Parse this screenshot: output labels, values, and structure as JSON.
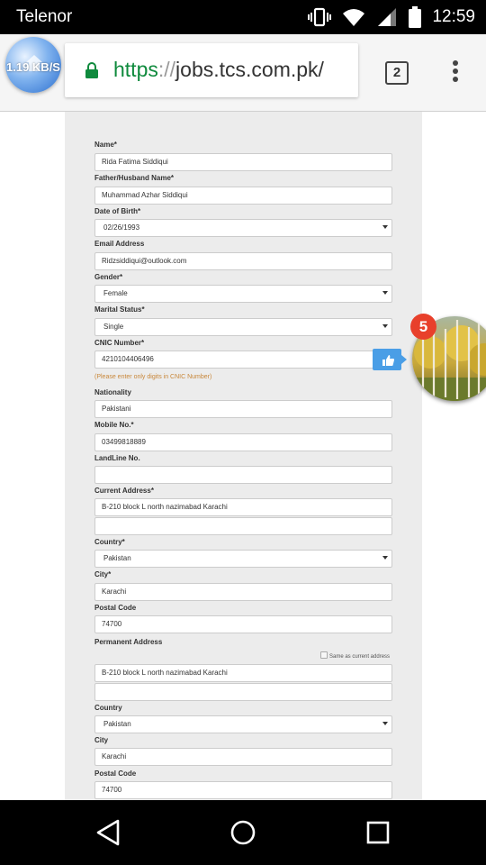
{
  "status_bar": {
    "carrier": "Telenor",
    "time": "12:59",
    "icons": [
      "vibrate-icon",
      "wifi-icon",
      "signal-icon",
      "battery-icon"
    ]
  },
  "browser": {
    "url_scheme": "https",
    "url_sep": "://",
    "url_rest": "jobs.tcs.com.pk/",
    "tab_count": "2",
    "speed_bubble": "1.19 KB/S"
  },
  "form": {
    "name": {
      "label": "Name*",
      "value": "Rida Fatima Siddiqui"
    },
    "father": {
      "label": "Father/Husband Name*",
      "value": "Muhammad Azhar Siddiqui"
    },
    "dob": {
      "label": "Date of Birth*",
      "value": "02/26/1993"
    },
    "email": {
      "label": "Email Address",
      "value": "Ridzsiddiqui@outlook.com"
    },
    "gender": {
      "label": "Gender*",
      "value": "Female"
    },
    "marital": {
      "label": "Marital Status*",
      "value": "Single"
    },
    "cnic": {
      "label": "CNIC Number*",
      "value": "4210104406496",
      "hint": "(Please enter only digits in CNIC Number)"
    },
    "nationality": {
      "label": "Nationality",
      "value": "Pakistani"
    },
    "mobile": {
      "label": "Mobile No.*",
      "value": "03499818889"
    },
    "landline": {
      "label": "LandLine No.",
      "value": ""
    },
    "current_address": {
      "label": "Current Address*",
      "line1": "B-210 block L north nazimabad Karachi",
      "line2": ""
    },
    "country": {
      "label": "Country*",
      "value": "Pakistan"
    },
    "city": {
      "label": "City*",
      "value": "Karachi"
    },
    "postal": {
      "label": "Postal Code",
      "value": "74700"
    },
    "permanent_address": {
      "label": "Permanent Address",
      "same_label": "Same as current address",
      "same_checked": false,
      "line1": "B-210 block L north nazimabad Karachi",
      "line2": ""
    },
    "perm_country": {
      "label": "Country",
      "value": "Pakistan"
    },
    "perm_city": {
      "label": "City",
      "value": "Karachi"
    },
    "perm_postal": {
      "label": "Postal Code",
      "value": "74700"
    }
  },
  "overlays": {
    "chathead_badge": "5",
    "like_icon": "thumbs-up-icon"
  },
  "colors": {
    "url_green": "#0f8a3d",
    "hint_orange": "#c8873a",
    "badge_red": "#e8402b",
    "like_blue": "#4a9ee6"
  }
}
